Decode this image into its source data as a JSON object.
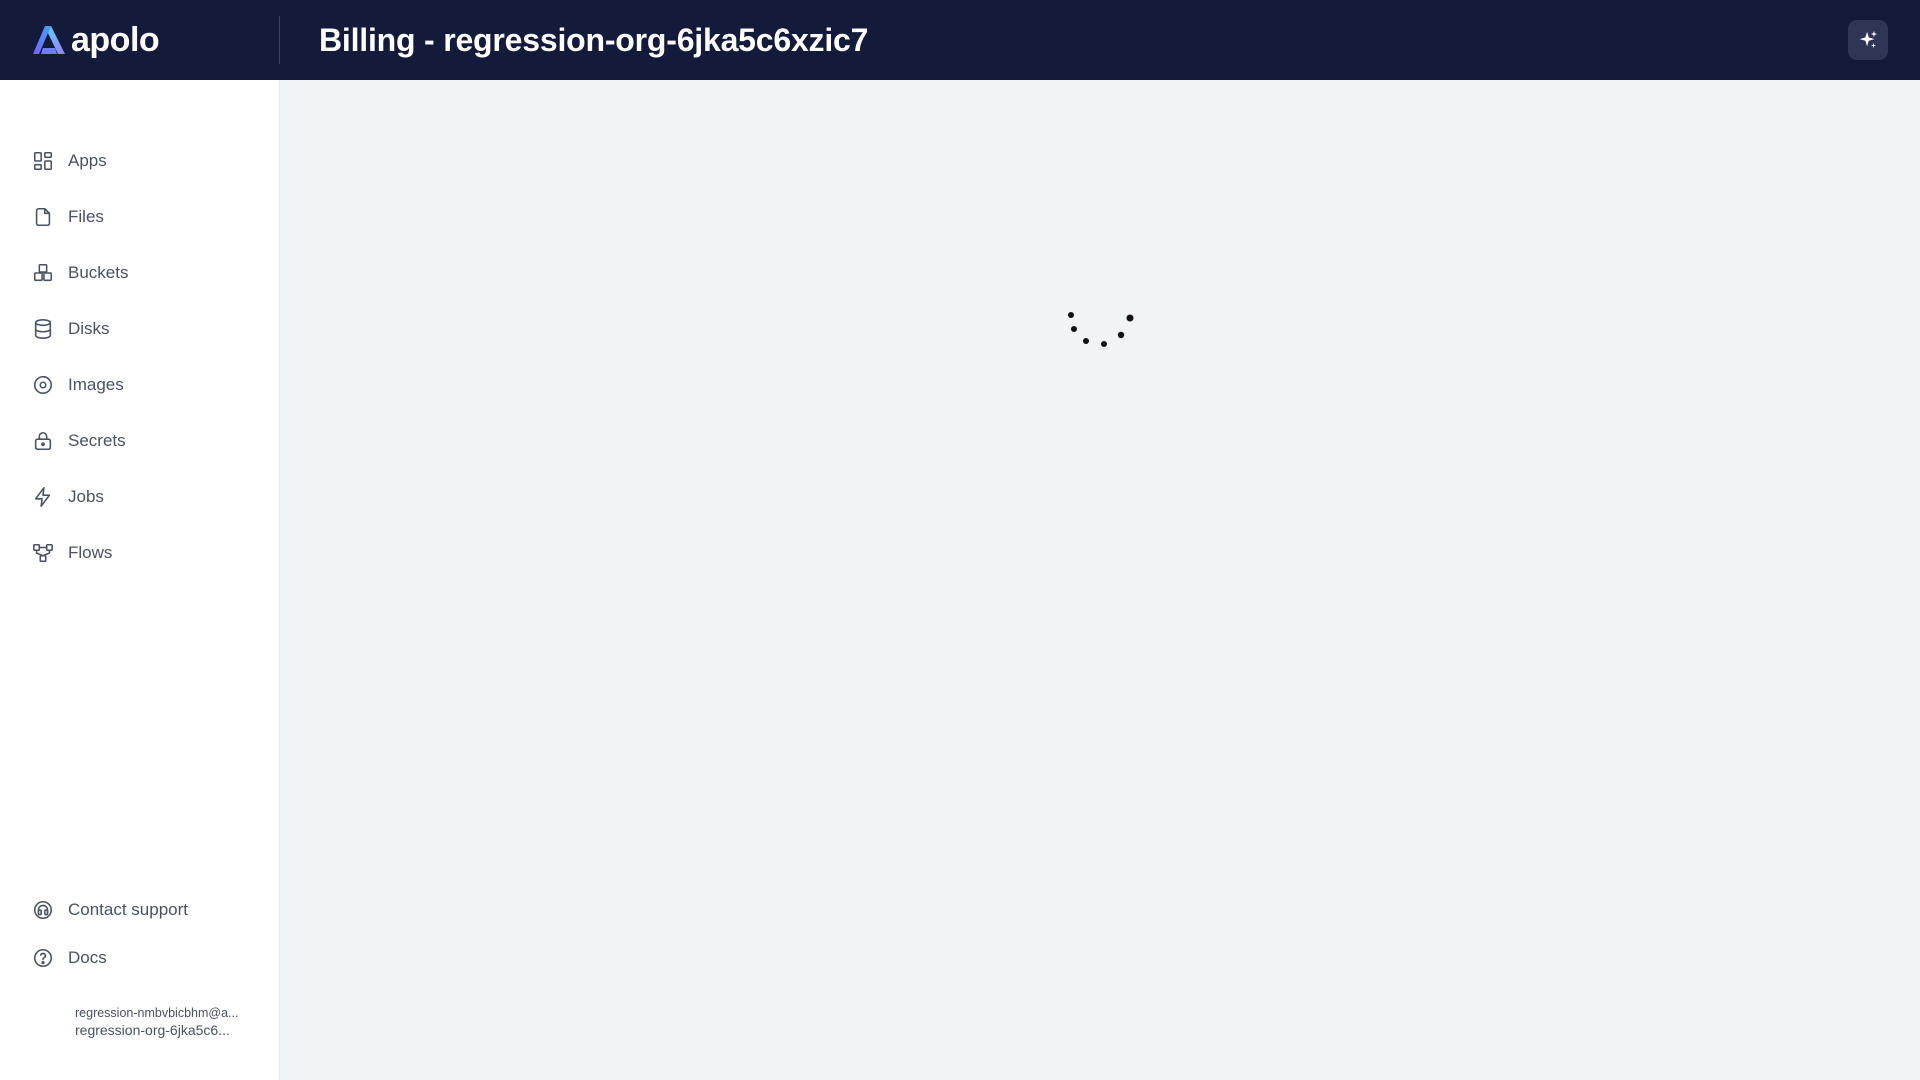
{
  "brand": {
    "name": "apolo"
  },
  "header": {
    "title": "Billing - regression-org-6jka5c6xzic7",
    "ai_button_icon": "sparkles-icon"
  },
  "sidebar": {
    "items": [
      {
        "label": "Apps",
        "icon": "grid-icon"
      },
      {
        "label": "Files",
        "icon": "file-icon"
      },
      {
        "label": "Buckets",
        "icon": "buckets-icon"
      },
      {
        "label": "Disks",
        "icon": "database-icon"
      },
      {
        "label": "Images",
        "icon": "disc-icon"
      },
      {
        "label": "Secrets",
        "icon": "lock-icon"
      },
      {
        "label": "Jobs",
        "icon": "lightning-icon"
      },
      {
        "label": "Flows",
        "icon": "flow-icon"
      }
    ],
    "bottom": [
      {
        "label": "Contact support",
        "icon": "headset-icon"
      },
      {
        "label": "Docs",
        "icon": "question-circle-icon"
      }
    ],
    "user": {
      "email": "regression-nmbvbicbhm@a...",
      "org": "regression-org-6jka5c6..."
    }
  },
  "main": {
    "state_icon": "loading-spinner-icon"
  },
  "colors": {
    "topbar": "#141a3a",
    "sidebar_bg": "#ffffff",
    "main_bg": "#f2f3f5",
    "nav_text": "#4a5163",
    "title_text": "#ffffff"
  }
}
